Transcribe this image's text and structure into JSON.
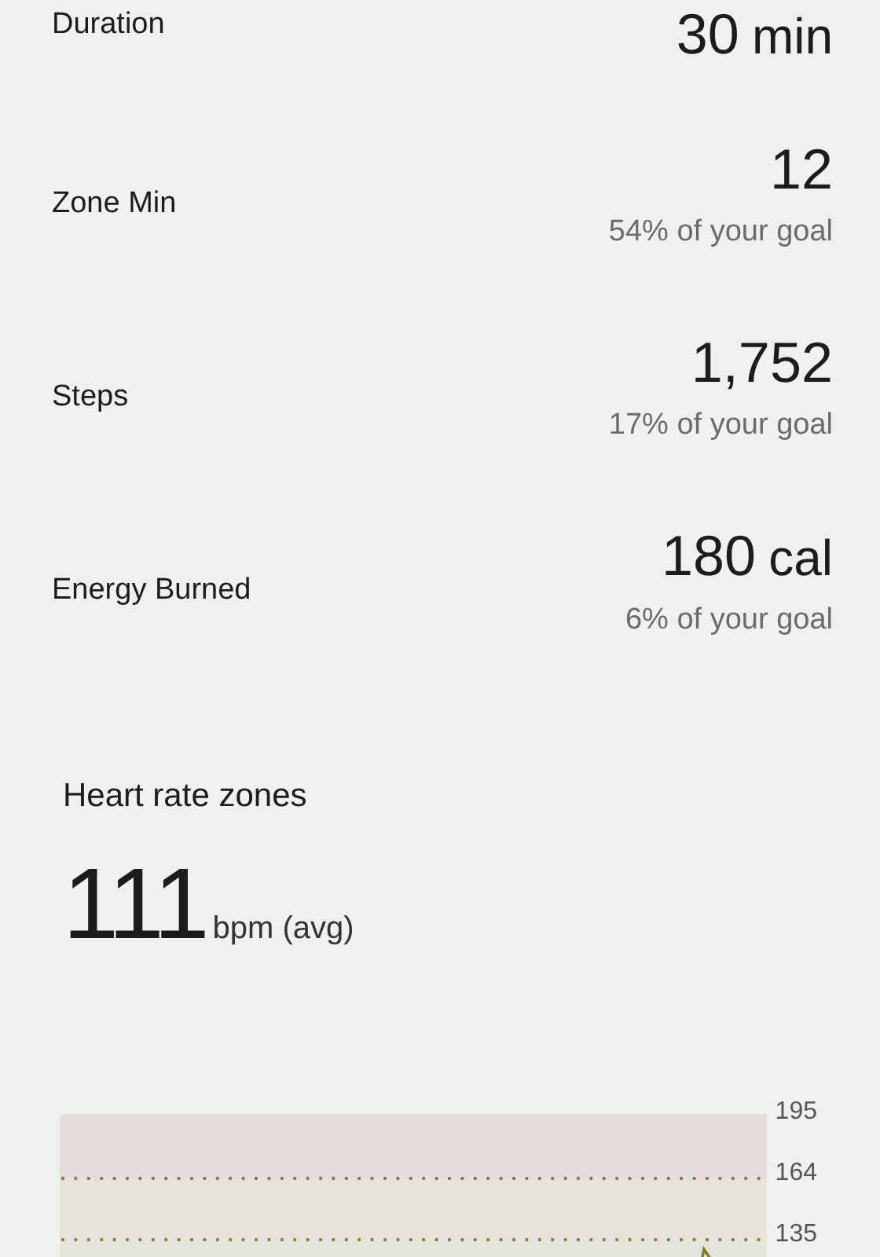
{
  "stats": [
    {
      "label": "Duration",
      "value": "30",
      "unit": "min"
    },
    {
      "label": "Zone Min",
      "value": "12",
      "goal": "54% of your goal"
    },
    {
      "label": "Steps",
      "value": "1,752",
      "goal": "17% of your goal"
    },
    {
      "label": "Energy Burned",
      "value": "180",
      "unit": "cal",
      "goal": "6% of your goal"
    }
  ],
  "heart_rate_zones": {
    "title": "Heart rate zones",
    "average": "111",
    "average_unit": "bpm (avg)",
    "axis_labels": [
      "195",
      "164",
      "135"
    ]
  }
}
